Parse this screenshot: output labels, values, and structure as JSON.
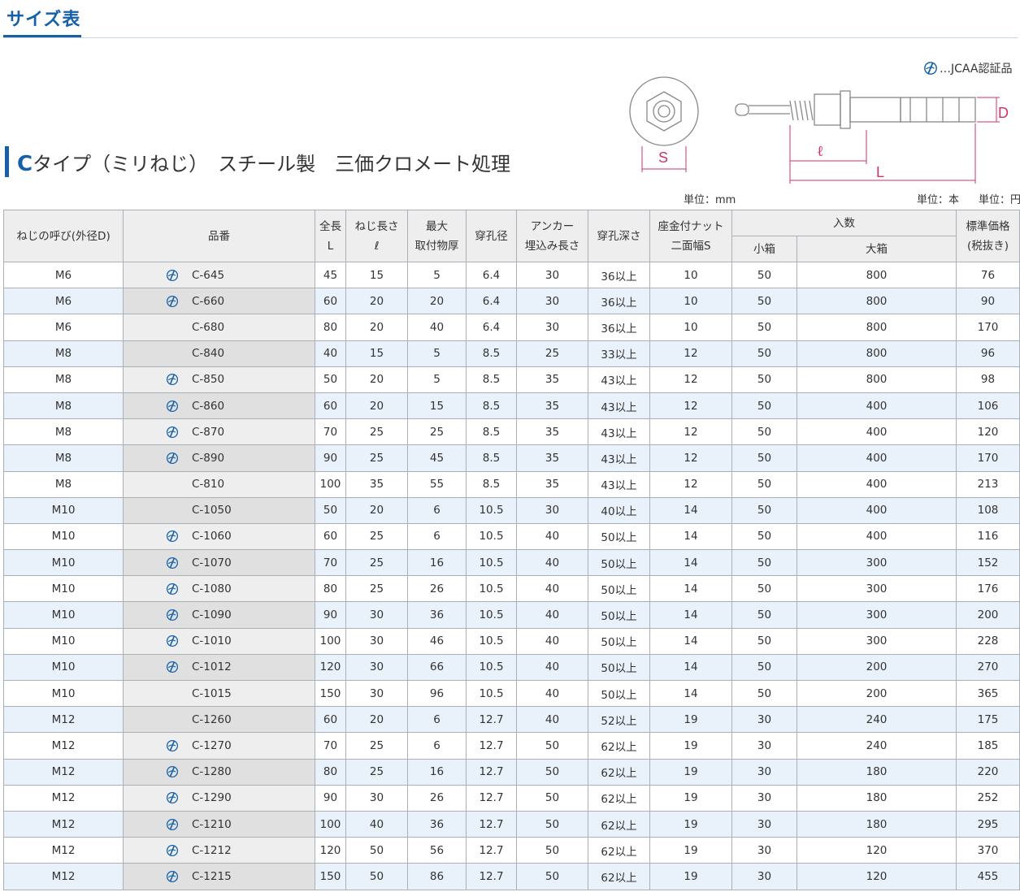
{
  "section_title": "サイズ表",
  "jcaa_legend": "…JCAA認証品",
  "type_heading": {
    "prefix": "C",
    "text": "タイプ（ミリねじ）　スチール製　三価クロメート処理"
  },
  "diagram": {
    "label_s": "S",
    "label_l": "L",
    "label_ell": "ℓ",
    "label_d": "D"
  },
  "units": {
    "mm": "単位：mm",
    "pieces": "単位：本",
    "yen": "単位：円"
  },
  "colors": {
    "accent": "#1560a8",
    "dimension": "#d0316a",
    "row_alt": "#e9f2fa"
  },
  "table": {
    "headers": {
      "nominal": "ねじの呼び(外径D)",
      "hinban": "品番",
      "length_1": "全長",
      "length_2": "L",
      "thread_1": "ねじ長さ",
      "thread_2": "ℓ",
      "max_1": "最大",
      "max_2": "取付物厚",
      "drill": "穿孔径",
      "embed_1": "アンカー",
      "embed_2": "埋込み長さ",
      "depth": "穿孔深さ",
      "nut_1": "座金付ナット",
      "nut_2": "二面幅S",
      "qty": "入数",
      "small_box": "小箱",
      "large_box": "大箱",
      "price_1": "標準価格",
      "price_2": "(税抜き)"
    },
    "rows": [
      {
        "nominal": "M6",
        "jcaa": true,
        "code": "C-645",
        "L": "45",
        "thread": "15",
        "max": "5",
        "drill": "6.4",
        "embed": "30",
        "depth": "36以上",
        "nut": "10",
        "small": "50",
        "large": "800",
        "price": "76"
      },
      {
        "nominal": "M6",
        "jcaa": true,
        "code": "C-660",
        "L": "60",
        "thread": "20",
        "max": "20",
        "drill": "6.4",
        "embed": "30",
        "depth": "36以上",
        "nut": "10",
        "small": "50",
        "large": "800",
        "price": "90"
      },
      {
        "nominal": "M6",
        "jcaa": false,
        "code": "C-680",
        "L": "80",
        "thread": "20",
        "max": "40",
        "drill": "6.4",
        "embed": "30",
        "depth": "36以上",
        "nut": "10",
        "small": "50",
        "large": "800",
        "price": "170"
      },
      {
        "nominal": "M8",
        "jcaa": false,
        "code": "C-840",
        "L": "40",
        "thread": "15",
        "max": "5",
        "drill": "8.5",
        "embed": "25",
        "depth": "33以上",
        "nut": "12",
        "small": "50",
        "large": "800",
        "price": "96"
      },
      {
        "nominal": "M8",
        "jcaa": true,
        "code": "C-850",
        "L": "50",
        "thread": "20",
        "max": "5",
        "drill": "8.5",
        "embed": "35",
        "depth": "43以上",
        "nut": "12",
        "small": "50",
        "large": "800",
        "price": "98"
      },
      {
        "nominal": "M8",
        "jcaa": true,
        "code": "C-860",
        "L": "60",
        "thread": "20",
        "max": "15",
        "drill": "8.5",
        "embed": "35",
        "depth": "43以上",
        "nut": "12",
        "small": "50",
        "large": "400",
        "price": "106"
      },
      {
        "nominal": "M8",
        "jcaa": true,
        "code": "C-870",
        "L": "70",
        "thread": "25",
        "max": "25",
        "drill": "8.5",
        "embed": "35",
        "depth": "43以上",
        "nut": "12",
        "small": "50",
        "large": "400",
        "price": "120"
      },
      {
        "nominal": "M8",
        "jcaa": true,
        "code": "C-890",
        "L": "90",
        "thread": "25",
        "max": "45",
        "drill": "8.5",
        "embed": "35",
        "depth": "43以上",
        "nut": "12",
        "small": "50",
        "large": "400",
        "price": "170"
      },
      {
        "nominal": "M8",
        "jcaa": false,
        "code": "C-810",
        "L": "100",
        "thread": "35",
        "max": "55",
        "drill": "8.5",
        "embed": "35",
        "depth": "43以上",
        "nut": "12",
        "small": "50",
        "large": "400",
        "price": "213"
      },
      {
        "nominal": "M10",
        "jcaa": false,
        "code": "C-1050",
        "L": "50",
        "thread": "20",
        "max": "6",
        "drill": "10.5",
        "embed": "30",
        "depth": "40以上",
        "nut": "14",
        "small": "50",
        "large": "400",
        "price": "108"
      },
      {
        "nominal": "M10",
        "jcaa": true,
        "code": "C-1060",
        "L": "60",
        "thread": "25",
        "max": "6",
        "drill": "10.5",
        "embed": "40",
        "depth": "50以上",
        "nut": "14",
        "small": "50",
        "large": "400",
        "price": "116"
      },
      {
        "nominal": "M10",
        "jcaa": true,
        "code": "C-1070",
        "L": "70",
        "thread": "25",
        "max": "16",
        "drill": "10.5",
        "embed": "40",
        "depth": "50以上",
        "nut": "14",
        "small": "50",
        "large": "300",
        "price": "152"
      },
      {
        "nominal": "M10",
        "jcaa": true,
        "code": "C-1080",
        "L": "80",
        "thread": "25",
        "max": "26",
        "drill": "10.5",
        "embed": "40",
        "depth": "50以上",
        "nut": "14",
        "small": "50",
        "large": "300",
        "price": "176"
      },
      {
        "nominal": "M10",
        "jcaa": true,
        "code": "C-1090",
        "L": "90",
        "thread": "30",
        "max": "36",
        "drill": "10.5",
        "embed": "40",
        "depth": "50以上",
        "nut": "14",
        "small": "50",
        "large": "300",
        "price": "200"
      },
      {
        "nominal": "M10",
        "jcaa": true,
        "code": "C-1010",
        "L": "100",
        "thread": "30",
        "max": "46",
        "drill": "10.5",
        "embed": "40",
        "depth": "50以上",
        "nut": "14",
        "small": "50",
        "large": "300",
        "price": "228"
      },
      {
        "nominal": "M10",
        "jcaa": true,
        "code": "C-1012",
        "L": "120",
        "thread": "30",
        "max": "66",
        "drill": "10.5",
        "embed": "40",
        "depth": "50以上",
        "nut": "14",
        "small": "50",
        "large": "200",
        "price": "270"
      },
      {
        "nominal": "M10",
        "jcaa": false,
        "code": "C-1015",
        "L": "150",
        "thread": "30",
        "max": "96",
        "drill": "10.5",
        "embed": "40",
        "depth": "50以上",
        "nut": "14",
        "small": "50",
        "large": "200",
        "price": "365"
      },
      {
        "nominal": "M12",
        "jcaa": false,
        "code": "C-1260",
        "L": "60",
        "thread": "20",
        "max": "6",
        "drill": "12.7",
        "embed": "40",
        "depth": "52以上",
        "nut": "19",
        "small": "30",
        "large": "240",
        "price": "175"
      },
      {
        "nominal": "M12",
        "jcaa": true,
        "code": "C-1270",
        "L": "70",
        "thread": "25",
        "max": "6",
        "drill": "12.7",
        "embed": "50",
        "depth": "62以上",
        "nut": "19",
        "small": "30",
        "large": "240",
        "price": "185"
      },
      {
        "nominal": "M12",
        "jcaa": true,
        "code": "C-1280",
        "L": "80",
        "thread": "25",
        "max": "16",
        "drill": "12.7",
        "embed": "50",
        "depth": "62以上",
        "nut": "19",
        "small": "30",
        "large": "180",
        "price": "220"
      },
      {
        "nominal": "M12",
        "jcaa": true,
        "code": "C-1290",
        "L": "90",
        "thread": "30",
        "max": "26",
        "drill": "12.7",
        "embed": "50",
        "depth": "62以上",
        "nut": "19",
        "small": "30",
        "large": "180",
        "price": "252"
      },
      {
        "nominal": "M12",
        "jcaa": true,
        "code": "C-1210",
        "L": "100",
        "thread": "40",
        "max": "36",
        "drill": "12.7",
        "embed": "50",
        "depth": "62以上",
        "nut": "19",
        "small": "30",
        "large": "180",
        "price": "295"
      },
      {
        "nominal": "M12",
        "jcaa": true,
        "code": "C-1212",
        "L": "120",
        "thread": "50",
        "max": "56",
        "drill": "12.7",
        "embed": "50",
        "depth": "62以上",
        "nut": "19",
        "small": "30",
        "large": "120",
        "price": "370"
      },
      {
        "nominal": "M12",
        "jcaa": true,
        "code": "C-1215",
        "L": "150",
        "thread": "50",
        "max": "86",
        "drill": "12.7",
        "embed": "50",
        "depth": "62以上",
        "nut": "19",
        "small": "30",
        "large": "120",
        "price": "455"
      }
    ]
  }
}
